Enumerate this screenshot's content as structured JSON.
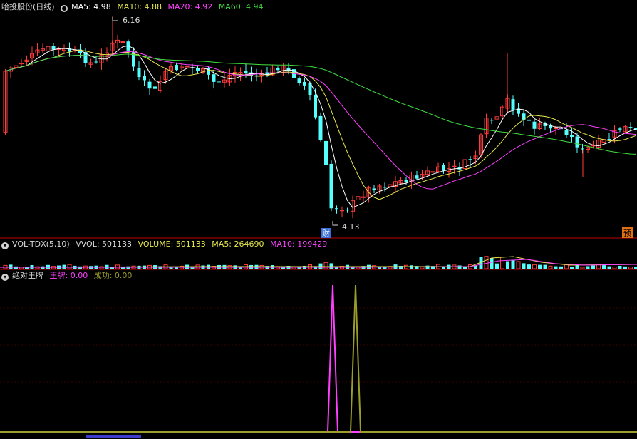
{
  "colors": {
    "background": "#000000",
    "separator": "#c00000",
    "grid": "#3a0000",
    "up": "#ff3c3c",
    "down": "#54ffff",
    "text": "#d8d8d8",
    "ma5": "#ffffff",
    "ma10": "#e8e84c",
    "ma20": "#ff40ff",
    "ma60": "#40e040",
    "olive": "#9c9c2c",
    "marker_fin_bg": "#3a6ed8",
    "marker_pred_bg": "#e07010"
  },
  "main_header": {
    "name": "哈投股份(日线)",
    "ma5": "MA5: 4.98",
    "ma10": "MA10: 4.88",
    "ma20": "MA20: 4.92",
    "ma60": "MA60: 4.94"
  },
  "vol_header": {
    "name": "VOL-TDX(5,10)",
    "vvol": "VVOL: 501133",
    "volume": "VOLUME: 501133",
    "ma5": "MA5: 264690",
    "ma10": "MA10: 199429"
  },
  "ind_header": {
    "name": "绝对王牌",
    "wangpai": "王牌: 0.00",
    "chenggong": "成功: 0.00"
  },
  "annotations": {
    "high": "6.16",
    "low": "4.13",
    "fin_marker": "财",
    "pred_marker": "预"
  }
}
